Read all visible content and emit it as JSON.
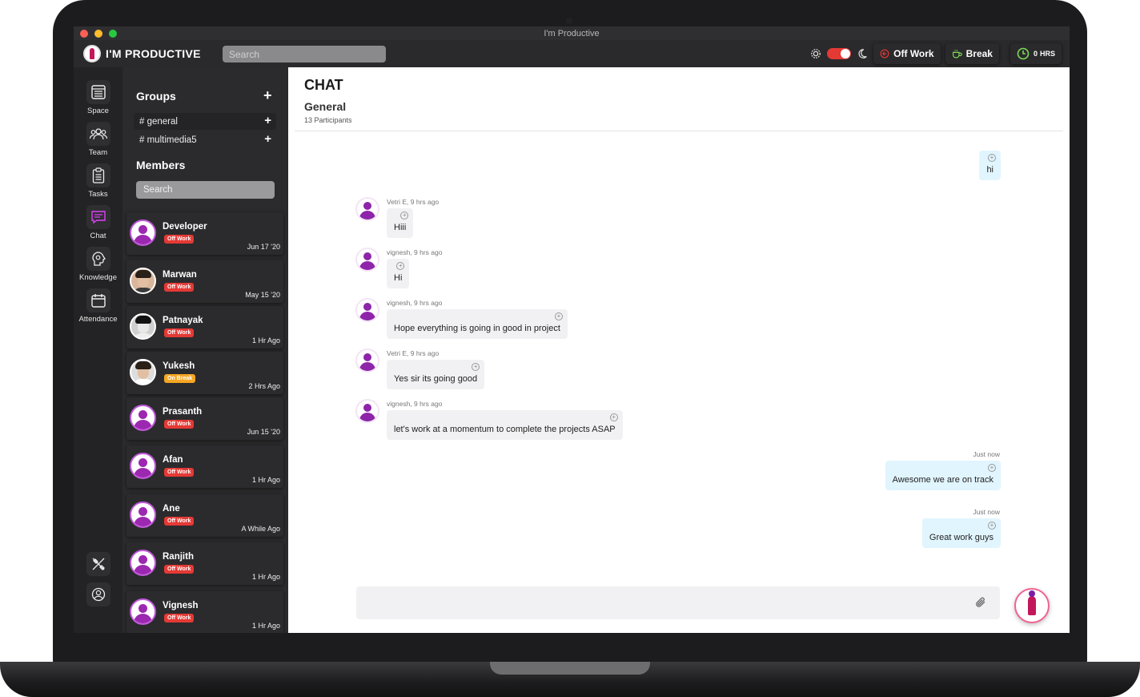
{
  "window": {
    "title": "I'm Productive"
  },
  "app": {
    "name": "I'M PRODUCTIVE",
    "search_placeholder": "Search"
  },
  "topbar": {
    "off_work_label": "Off Work",
    "break_label": "Break",
    "hours_value": "0",
    "hours_unit": "HRS",
    "status_color": "#e53935"
  },
  "rail": {
    "items": [
      {
        "label": "Space",
        "icon": "space-icon"
      },
      {
        "label": "Team",
        "icon": "team-icon"
      },
      {
        "label": "Tasks",
        "icon": "tasks-icon"
      },
      {
        "label": "Chat",
        "icon": "chat-icon"
      },
      {
        "label": "Knowledge",
        "icon": "knowledge-icon"
      },
      {
        "label": "Attendance",
        "icon": "attendance-icon"
      }
    ]
  },
  "sidebar": {
    "groups_title": "Groups",
    "groups": [
      {
        "name": "# general"
      },
      {
        "name": "# multimedia5"
      }
    ],
    "members_title": "Members",
    "members_search_placeholder": "Search",
    "members": [
      {
        "name": "Developer",
        "status": "Off Work",
        "time": "Jun 17 '20"
      },
      {
        "name": "Marwan",
        "status": "Off Work",
        "time": "May 15 '20"
      },
      {
        "name": "Patnayak",
        "status": "Off Work",
        "time": "1 Hr Ago"
      },
      {
        "name": "Yukesh",
        "status": "On Break",
        "time": "2 Hrs Ago"
      },
      {
        "name": "Prasanth",
        "status": "Off Work",
        "time": "Jun 15 '20"
      },
      {
        "name": "Afan",
        "status": "Off Work",
        "time": "1 Hr Ago"
      },
      {
        "name": "Ane",
        "status": "Off Work",
        "time": "A While Ago"
      },
      {
        "name": "Ranjith",
        "status": "Off Work",
        "time": "1 Hr Ago"
      },
      {
        "name": "Vignesh",
        "status": "Off Work",
        "time": "1 Hr Ago"
      }
    ]
  },
  "chat": {
    "title": "CHAT",
    "channel": "General",
    "participants": "13 Participants",
    "messages": [
      {
        "mine": true,
        "meta": "",
        "text": "hi"
      },
      {
        "mine": false,
        "meta": "Vetri E, 9 hrs ago",
        "text": "Hiii"
      },
      {
        "mine": false,
        "meta": "vignesh, 9 hrs ago",
        "text": "Hi"
      },
      {
        "mine": false,
        "meta": "vignesh, 9 hrs ago",
        "text": "Hope everything is going in good in project"
      },
      {
        "mine": false,
        "meta": "Vetri E, 9 hrs ago",
        "text": "Yes sir its going good"
      },
      {
        "mine": false,
        "meta": "vignesh, 9 hrs ago",
        "text": "let's work at a momentum to complete the projects ASAP"
      },
      {
        "mine": true,
        "meta": "Just now",
        "text": "Awesome we are on track"
      },
      {
        "mine": true,
        "meta": "Just now",
        "text": "Great work guys"
      }
    ]
  }
}
